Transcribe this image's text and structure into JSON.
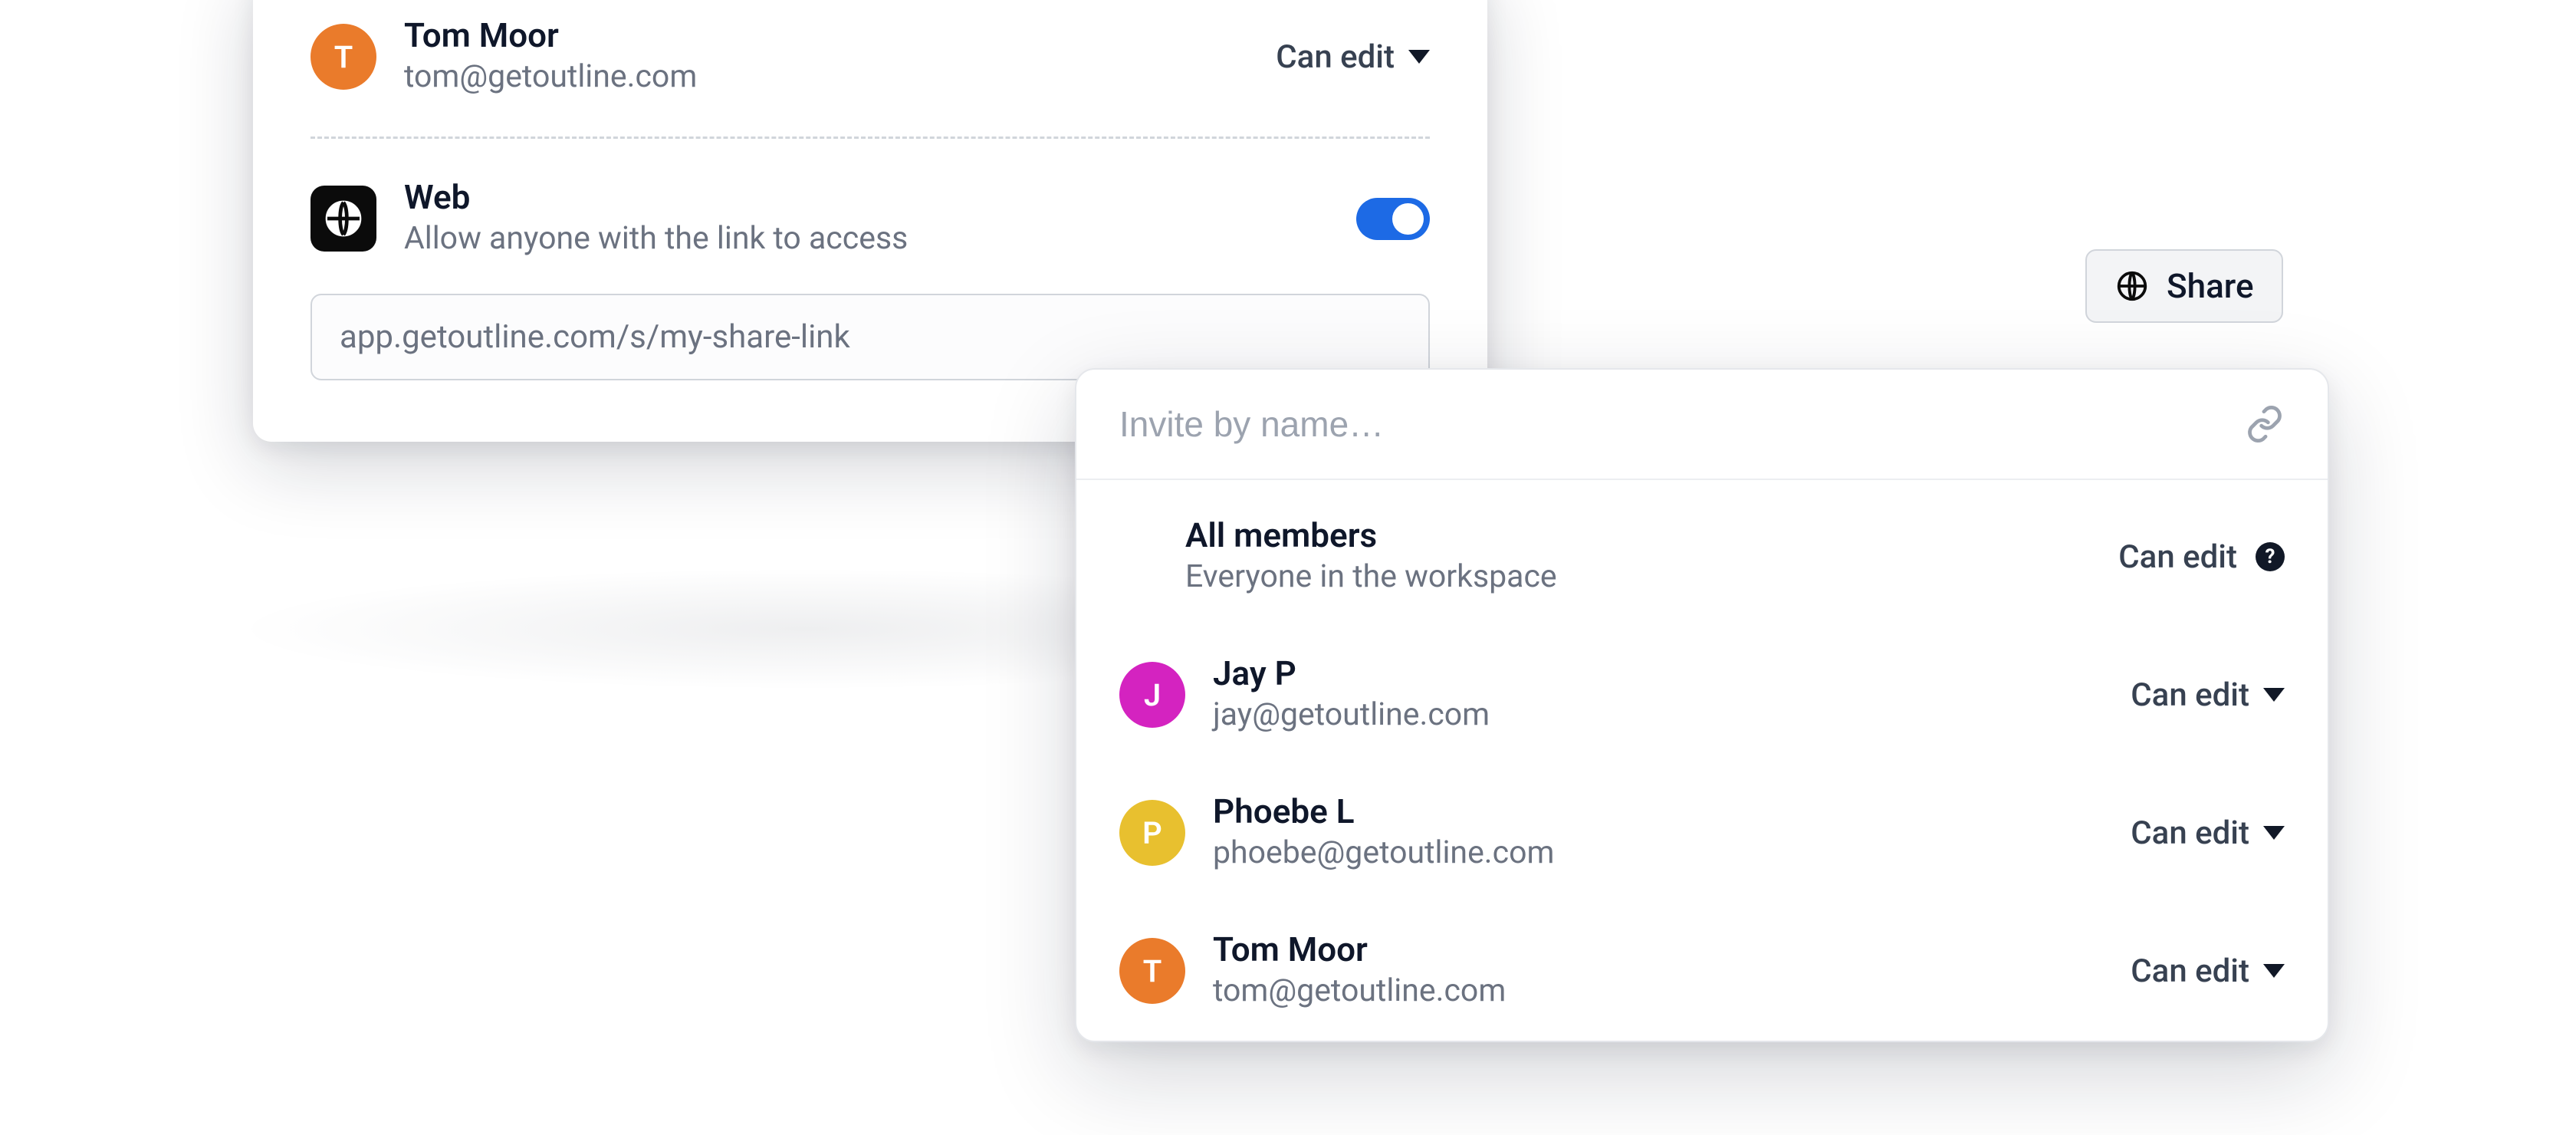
{
  "left_panel": {
    "user": {
      "initial": "T",
      "name": "Tom Moor",
      "email": "tom@getoutline.com",
      "permission": "Can edit"
    },
    "web": {
      "title": "Web",
      "subtitle": "Allow anyone with the link to access",
      "toggle_on": true
    },
    "share_url": "app.getoutline.com/s/my-share-link"
  },
  "share_button_label": "Share",
  "right_panel": {
    "search_placeholder": "Invite by name…",
    "members": [
      {
        "initial": "",
        "avatar_type": "blue-sq",
        "name": "All members",
        "sub": "Everyone in the workspace",
        "permission": "Can edit",
        "has_help": true
      },
      {
        "initial": "J",
        "avatar_type": "magenta",
        "name": "Jay P",
        "sub": "jay@getoutline.com",
        "permission": "Can edit",
        "has_help": false
      },
      {
        "initial": "P",
        "avatar_type": "yellow",
        "name": "Phoebe L",
        "sub": "phoebe@getoutline.com",
        "permission": "Can edit",
        "has_help": false
      },
      {
        "initial": "T",
        "avatar_type": "orange",
        "name": "Tom Moor",
        "sub": "tom@getoutline.com",
        "permission": "Can edit",
        "has_help": false
      }
    ]
  }
}
